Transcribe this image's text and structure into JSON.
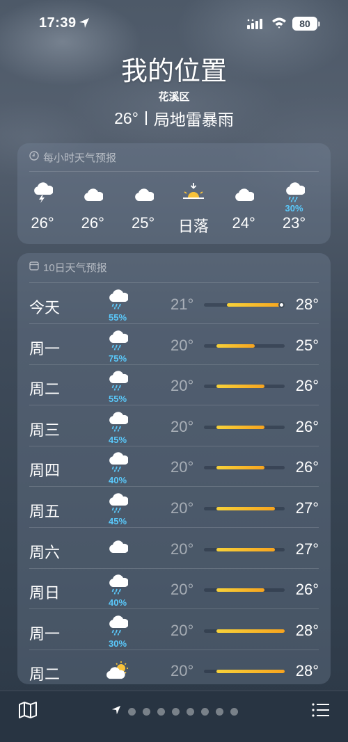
{
  "status_bar": {
    "time": "17:39",
    "battery": "80"
  },
  "header": {
    "city": "我的位置",
    "district": "花溪区",
    "temperature": "26°",
    "condition": "局地雷暴雨"
  },
  "hourly": {
    "title": "每小时天气预报",
    "items": [
      {
        "icon": "thunderstorm-icon",
        "prob": "",
        "temp": "26°"
      },
      {
        "icon": "cloud-icon",
        "prob": "",
        "temp": "26°"
      },
      {
        "icon": "cloud-icon",
        "prob": "",
        "temp": "25°"
      },
      {
        "icon": "sunset-icon",
        "prob": "",
        "temp": "日落"
      },
      {
        "icon": "cloud-icon",
        "prob": "",
        "temp": "24°"
      },
      {
        "icon": "rain-cloud-icon",
        "prob": "30%",
        "temp": "23°"
      }
    ]
  },
  "daily": {
    "title": "10日天气预报",
    "range_min": 20,
    "range_max": 28,
    "days": [
      {
        "name": "今天",
        "icon": "rain-cloud-icon",
        "prob": "55%",
        "low": "21°",
        "high": "28°",
        "lo": 21,
        "hi": 28,
        "current": 26
      },
      {
        "name": "周一",
        "icon": "rain-cloud-icon",
        "prob": "75%",
        "low": "20°",
        "high": "25°",
        "lo": 20,
        "hi": 25
      },
      {
        "name": "周二",
        "icon": "rain-cloud-icon",
        "prob": "55%",
        "low": "20°",
        "high": "26°",
        "lo": 20,
        "hi": 26
      },
      {
        "name": "周三",
        "icon": "rain-cloud-icon",
        "prob": "45%",
        "low": "20°",
        "high": "26°",
        "lo": 20,
        "hi": 26
      },
      {
        "name": "周四",
        "icon": "rain-cloud-icon",
        "prob": "40%",
        "low": "20°",
        "high": "26°",
        "lo": 20,
        "hi": 26
      },
      {
        "name": "周五",
        "icon": "rain-cloud-icon",
        "prob": "45%",
        "low": "20°",
        "high": "27°",
        "lo": 20,
        "hi": 27
      },
      {
        "name": "周六",
        "icon": "cloud-icon",
        "prob": "",
        "low": "20°",
        "high": "27°",
        "lo": 20,
        "hi": 27
      },
      {
        "name": "周日",
        "icon": "rain-cloud-icon",
        "prob": "40%",
        "low": "20°",
        "high": "26°",
        "lo": 20,
        "hi": 26
      },
      {
        "name": "周一",
        "icon": "rain-cloud-icon",
        "prob": "30%",
        "low": "20°",
        "high": "28°",
        "lo": 20,
        "hi": 28
      },
      {
        "name": "周二",
        "icon": "partly-sunny-icon",
        "prob": "",
        "low": "20°",
        "high": "28°",
        "lo": 20,
        "hi": 28
      }
    ]
  },
  "pager": {
    "pages": 8
  }
}
